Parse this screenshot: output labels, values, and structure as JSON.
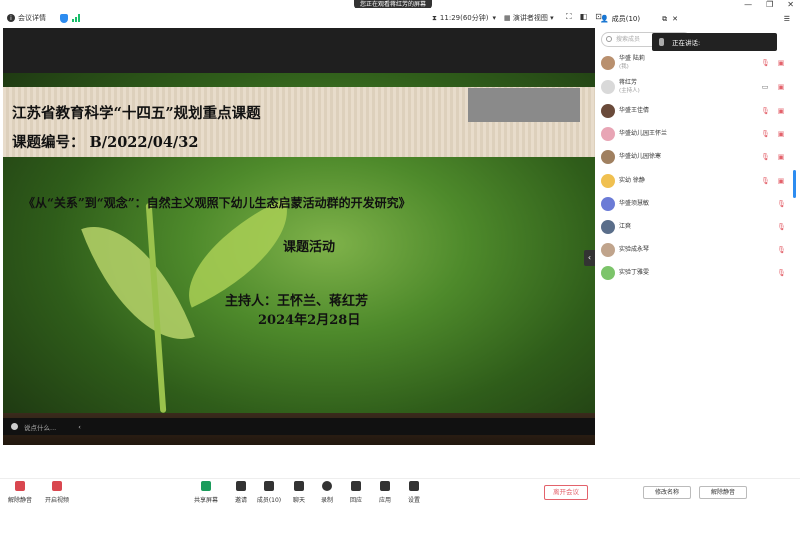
{
  "top": {
    "meeting_info": "会议详情",
    "sharing": "您正在观看蒋红芳的屏幕",
    "timer": "11:29(60分钟)",
    "view_mode": "演讲者视图",
    "members_header": "成员(10)"
  },
  "slide": {
    "title1": "江苏省教育科学“十四五”规划重点课题",
    "title2": "课题编号：  B/2022/04/32",
    "main_title": "《从“关系”到“观念”：自然主义观照下幼儿生态启蒙活动群的开发研究》",
    "subtitle": "课题活动",
    "host": "主持人：王怀兰、蒋红芳",
    "date": "2024年2月28日"
  },
  "chat": {
    "placeholder": "说点什么..."
  },
  "panel": {
    "search_placeholder": "搜索成员",
    "speaking_label": "正在讲话:",
    "members": [
      {
        "name": "华盛 陆莉",
        "role": "(我)"
      },
      {
        "name": "蒋红芳",
        "role": "(主持人)"
      },
      {
        "name": "华盛王佳倩",
        "role": ""
      },
      {
        "name": "华盛幼儿园王怀兰",
        "role": ""
      },
      {
        "name": "华盛幼儿园徐寒",
        "role": ""
      },
      {
        "name": "实幼 徐静",
        "role": ""
      },
      {
        "name": "华盛须慧敏",
        "role": ""
      },
      {
        "name": "江爽",
        "role": ""
      },
      {
        "name": "实验成永琴",
        "role": ""
      },
      {
        "name": "实验丁雅雯",
        "role": ""
      }
    ]
  },
  "toolbar": {
    "unmute": "解除静音",
    "start_video": "开启视频",
    "share_screen": "共享屏幕",
    "invite": "邀请",
    "members": "成员(10)",
    "chat": "聊天",
    "record": "录制",
    "reaction": "回应",
    "apps": "应用",
    "settings": "设置",
    "leave": "离开会议",
    "rename": "修改名称",
    "unmute_all": "解除静音"
  }
}
